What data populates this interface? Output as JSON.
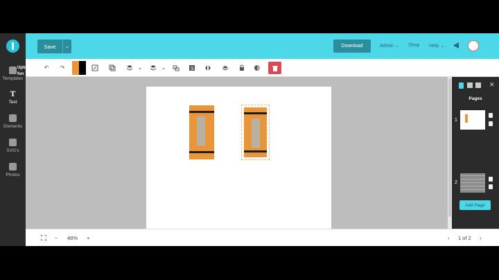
{
  "sidebar": {
    "upload_partial": "Uplo fon",
    "templates_label": "Templates",
    "text_label": "Text",
    "text_glyph": "T",
    "elements_label": "Elements",
    "svgs_label": "SVG's",
    "photos_label": "Photos"
  },
  "topbar": {
    "save_label": "Save",
    "save_dd": "⌄",
    "download_label": "Download",
    "admin_label": "Admin ⌄",
    "shop_label": "Shop",
    "help_label": "Help ⌄"
  },
  "toolbar": {
    "undo": "↶",
    "redo": "↷",
    "colors": {
      "fill": "#e9953a",
      "stroke": "#000000"
    },
    "delete_icon": "🗑"
  },
  "pages_panel": {
    "title": "Pages",
    "pages": [
      {
        "num": "1"
      },
      {
        "num": "2"
      }
    ],
    "add_page_label": "Add Page"
  },
  "bottombar": {
    "zoom_out": "−",
    "zoom_level": "48%",
    "zoom_in": "+",
    "prev": "‹",
    "page_indicator": "1 of 2",
    "next": "›"
  },
  "colors": {
    "accent": "#4dd8ea",
    "dark_button": "#2c8e9c",
    "sidebar": "#2b2b2b",
    "delete": "#d94a55"
  }
}
